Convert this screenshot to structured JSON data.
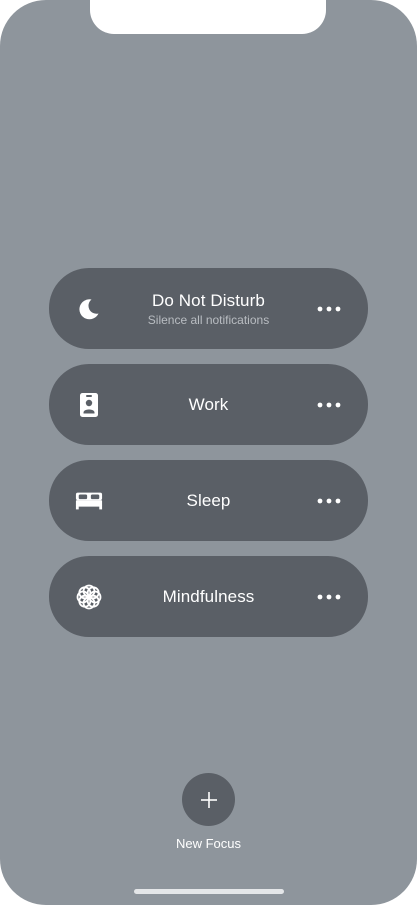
{
  "focus_modes": [
    {
      "title": "Do Not Disturb",
      "subtitle": "Silence all notifications",
      "icon": "moon-icon"
    },
    {
      "title": "Work",
      "subtitle": "",
      "icon": "id-badge-icon"
    },
    {
      "title": "Sleep",
      "subtitle": "",
      "icon": "bed-icon"
    },
    {
      "title": "Mindfulness",
      "subtitle": "",
      "icon": "flower-icon"
    }
  ],
  "new_focus": {
    "label": "New Focus",
    "icon": "plus-icon"
  },
  "colors": {
    "background": "#8e959c",
    "row": "#5a5f66",
    "text": "#ffffff",
    "subtext": "#b9bdc2"
  }
}
